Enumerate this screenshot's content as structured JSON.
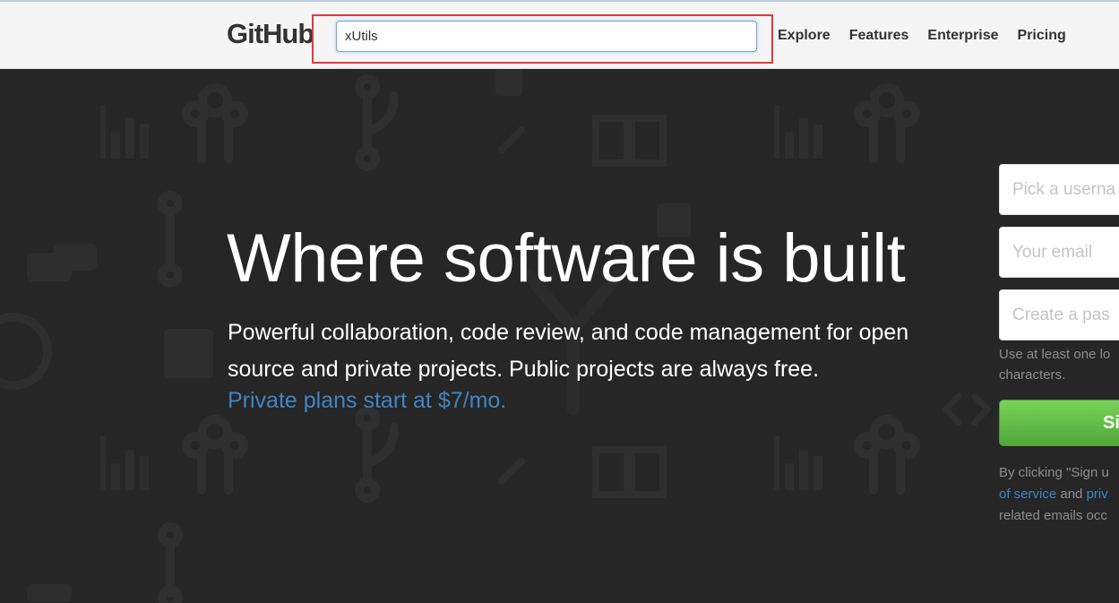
{
  "header": {
    "logo": "GitHub",
    "search": {
      "value": "xUtils",
      "highlighted": true,
      "highlight_color": "#e03b3b"
    },
    "nav": [
      "Explore",
      "Features",
      "Enterprise",
      "Pricing"
    ]
  },
  "hero": {
    "title": "Where software is built",
    "subtitle": "Powerful collaboration, code review, and code management for open source and private projects. Public projects are always free.",
    "link": "Private plans start at $7/mo.",
    "link_color": "#4183c4",
    "background_color": "#262626"
  },
  "signup": {
    "username_placeholder": "Pick a userna",
    "email_placeholder": "Your email",
    "password_placeholder": "Create a pas",
    "password_hint_line1": "Use at least one lo",
    "password_hint_line2": "characters.",
    "button_label": "Si",
    "button_color": "#5cb845",
    "terms_line1": "By clicking \"Sign u",
    "terms_link1": "of service",
    "terms_and": " and ",
    "terms_link2": "priv",
    "terms_line3": "related emails occ"
  }
}
